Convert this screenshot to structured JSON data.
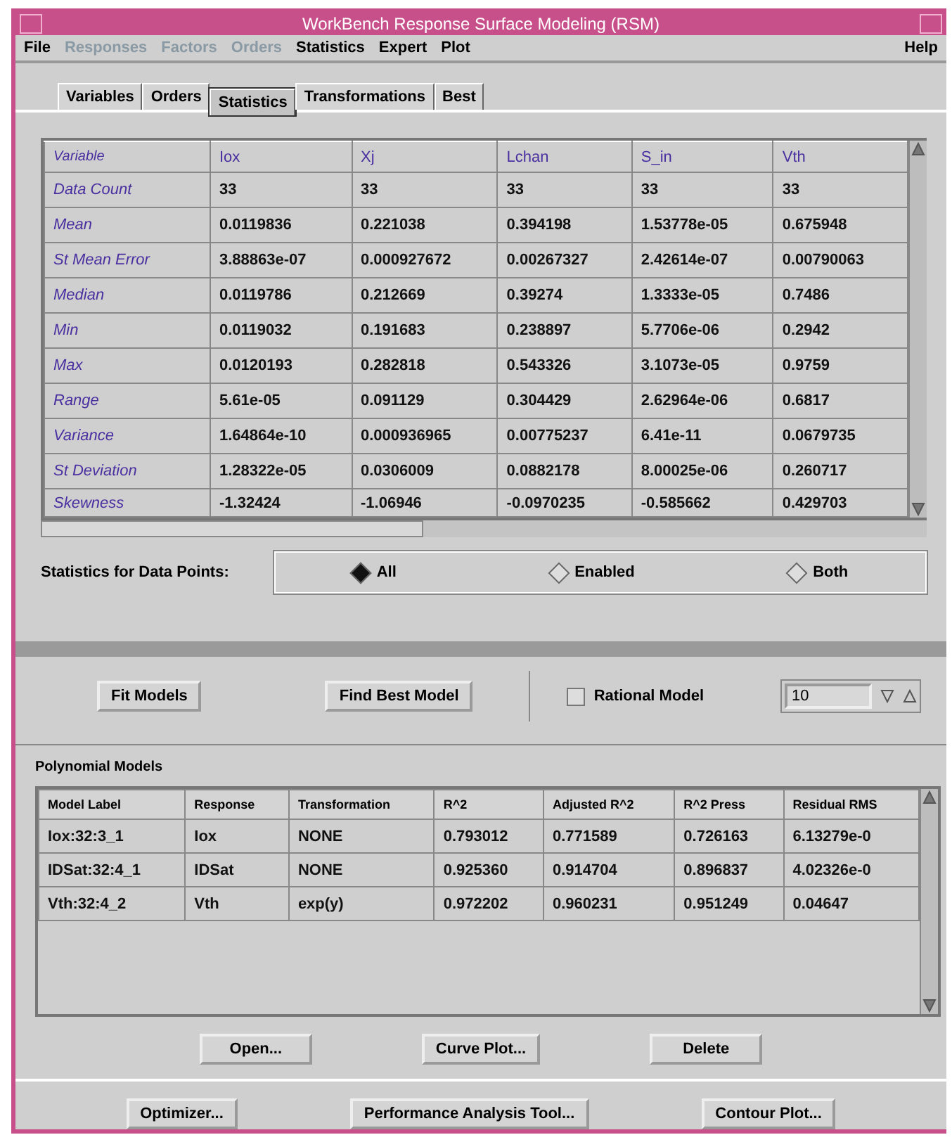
{
  "window": {
    "title": "WorkBench Response Surface Modeling (RSM)"
  },
  "menu": [
    {
      "label": "File",
      "disabled": false
    },
    {
      "label": "Responses",
      "disabled": true
    },
    {
      "label": "Factors",
      "disabled": true
    },
    {
      "label": "Orders",
      "disabled": true
    },
    {
      "label": "Statistics",
      "disabled": false
    },
    {
      "label": "Expert",
      "disabled": false
    },
    {
      "label": "Plot",
      "disabled": false
    },
    {
      "label": "Help",
      "disabled": false
    }
  ],
  "tabs": [
    {
      "label": "Variables",
      "selected": false
    },
    {
      "label": "Orders",
      "selected": false
    },
    {
      "label": "Statistics",
      "selected": true
    },
    {
      "label": "Transformations",
      "selected": false
    },
    {
      "label": "Best",
      "selected": false
    }
  ],
  "statistics_table": {
    "columns": [
      "Variable",
      "Iox",
      "Xj",
      "Lchan",
      "S_in",
      "Vth"
    ],
    "rows": [
      [
        "Data Count",
        "33",
        "33",
        "33",
        "33",
        "33"
      ],
      [
        "Mean",
        "0.0119836",
        "0.221038",
        "0.394198",
        "1.53778e-05",
        "0.675948"
      ],
      [
        "St Mean Error",
        "3.88863e-07",
        "0.000927672",
        "0.00267327",
        "2.42614e-07",
        "0.00790063"
      ],
      [
        "Median",
        "0.0119786",
        "0.212669",
        "0.39274",
        "1.3333e-05",
        "0.7486"
      ],
      [
        "Min",
        "0.0119032",
        "0.191683",
        "0.238897",
        "5.7706e-06",
        "0.2942"
      ],
      [
        "Max",
        "0.0120193",
        "0.282818",
        "0.543326",
        "3.1073e-05",
        "0.9759"
      ],
      [
        "Range",
        "5.61e-05",
        "0.091129",
        "0.304429",
        "2.62964e-06",
        "0.6817"
      ],
      [
        "Variance",
        "1.64864e-10",
        "0.000936965",
        "0.00775237",
        "6.41e-11",
        "0.0679735"
      ],
      [
        "St Deviation",
        "1.28322e-05",
        "0.0306009",
        "0.0882178",
        "8.00025e-06",
        "0.260717"
      ],
      [
        "Skewness",
        "-1.32424",
        "-1.06946",
        "-0.0970235",
        "-0.585662",
        "0.429703"
      ]
    ]
  },
  "data_points": {
    "label": "Statistics for Data Points:",
    "options": [
      {
        "label": "All",
        "selected": true
      },
      {
        "label": "Enabled",
        "selected": false
      },
      {
        "label": "Both",
        "selected": false
      }
    ]
  },
  "fit_buttons": [
    "Fit Models",
    "Find Best Model"
  ],
  "rational_model": {
    "label": "Rational Model",
    "checked": false
  },
  "count_field": {
    "value": "10"
  },
  "polynomial_models": {
    "title": "Polynomial Models",
    "columns": [
      "Model Label",
      "Response",
      "Transformation",
      "R^2",
      "Adjusted R^2",
      "R^2 Press",
      "Residual RMS"
    ],
    "rows": [
      [
        "Iox:32:3_1",
        "Iox",
        "NONE",
        "0.793012",
        "0.771589",
        "0.726163",
        "6.13279e-0"
      ],
      [
        "IDSat:32:4_1",
        "IDSat",
        "NONE",
        "0.925360",
        "0.914704",
        "0.896837",
        "4.02326e-0"
      ],
      [
        "Vth:32:4_2",
        "Vth",
        "exp(y)",
        "0.972202",
        "0.960231",
        "0.951249",
        "0.04647"
      ]
    ]
  },
  "model_buttons": [
    "Open...",
    "Curve Plot...",
    "Delete"
  ],
  "tool_buttons": [
    "Optimizer...",
    "Performance Analysis Tool...",
    "Contour Plot..."
  ]
}
